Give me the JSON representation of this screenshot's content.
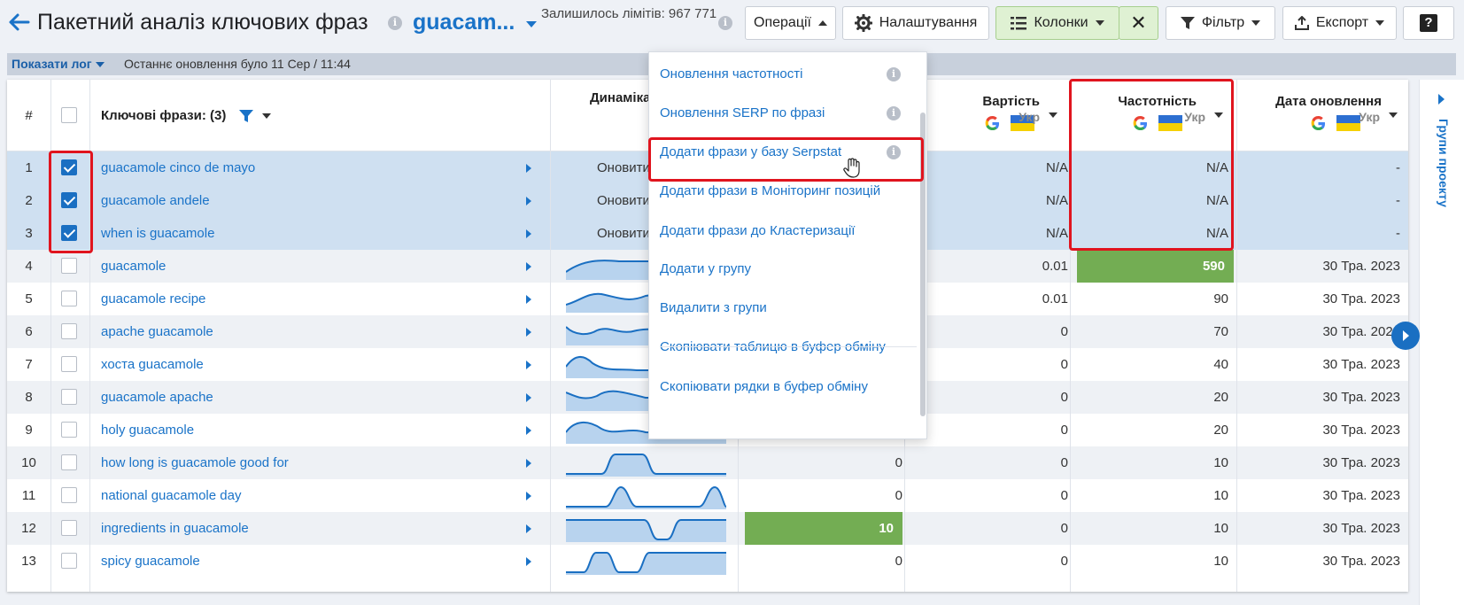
{
  "header": {
    "title": "Пакетний аналіз ключових фраз",
    "project": "guacam...",
    "limits": "Залишилось лімітів: 967 771",
    "buttons": {
      "operations": "Операції",
      "settings": "Налаштування",
      "columns": "Колонки",
      "filter": "Фільтр",
      "export": "Експорт"
    }
  },
  "logbar": {
    "toggle": "Показати лог",
    "text": "Останнє оновлення було 11 Сер / 11:44"
  },
  "table": {
    "headers": {
      "num": "#",
      "keywords": "Ключові фрази: (3)",
      "dynamics": "Динаміка",
      "cost": "Вартість",
      "frequency": "Частотність",
      "updated": "Дата оновлення",
      "region": "Укр"
    },
    "rows": [
      {
        "n": "1",
        "kw": "guacamole cinco de mayo",
        "checked": true,
        "update": "Оновити",
        "v1": "",
        "cost": "N/A",
        "freq": "N/A",
        "date": "-"
      },
      {
        "n": "2",
        "kw": "guacamole andele",
        "checked": true,
        "update": "Оновити",
        "v1": "",
        "cost": "N/A",
        "freq": "N/A",
        "date": "-"
      },
      {
        "n": "3",
        "kw": "when is guacamole",
        "checked": true,
        "update": "Оновити",
        "v1": "",
        "cost": "N/A",
        "freq": "N/A",
        "date": "-"
      },
      {
        "n": "4",
        "kw": "guacamole",
        "checked": false,
        "update": "",
        "v1": "",
        "cost": "0.01",
        "freq": "590",
        "date": "30 Тра. 2023",
        "freqHl": true
      },
      {
        "n": "5",
        "kw": "guacamole recipe",
        "checked": false,
        "update": "",
        "v1": "",
        "cost": "0.01",
        "freq": "90",
        "date": "30 Тра. 2023"
      },
      {
        "n": "6",
        "kw": "apache guacamole",
        "checked": false,
        "update": "",
        "v1": "",
        "cost": "0",
        "freq": "70",
        "date": "30 Тра. 2023"
      },
      {
        "n": "7",
        "kw": "хоста guacamole",
        "checked": false,
        "update": "",
        "v1": "",
        "cost": "0",
        "freq": "40",
        "date": "30 Тра. 2023"
      },
      {
        "n": "8",
        "kw": "guacamole apache",
        "checked": false,
        "update": "",
        "v1": "",
        "cost": "0",
        "freq": "20",
        "date": "30 Тра. 2023"
      },
      {
        "n": "9",
        "kw": "holy guacamole",
        "checked": false,
        "update": "",
        "v1": "",
        "cost": "0",
        "freq": "20",
        "date": "30 Тра. 2023"
      },
      {
        "n": "10",
        "kw": "how long is guacamole good for",
        "checked": false,
        "update": "",
        "v1": "0",
        "cost": "0",
        "freq": "10",
        "date": "30 Тра. 2023"
      },
      {
        "n": "11",
        "kw": "national guacamole day",
        "checked": false,
        "update": "",
        "v1": "0",
        "cost": "0",
        "freq": "10",
        "date": "30 Тра. 2023"
      },
      {
        "n": "12",
        "kw": "ingredients in guacamole",
        "checked": false,
        "update": "",
        "v1": "10",
        "cost": "0",
        "freq": "10",
        "date": "30 Тра. 2023",
        "v1Hl": true
      },
      {
        "n": "13",
        "kw": "spicy guacamole",
        "checked": false,
        "update": "",
        "v1": "0",
        "cost": "0",
        "freq": "10",
        "date": "30 Тра. 2023"
      }
    ]
  },
  "dropdown": {
    "items": [
      "Оновлення частотності",
      "Оновлення SERP по фразі",
      "Додати фрази у базу Serpstat",
      "Додати фрази в Моніторинг позицій",
      "Додати фрази до Кластеризації",
      "Додати у групу",
      "Видалити з групи",
      "Скопіювати таблицю в буфер обміну",
      "Скопіювати рядки в буфер обміну"
    ]
  },
  "side": {
    "label": "Групи проекту"
  },
  "colors": {
    "accent": "#1a73c8",
    "highlight": "#e0141e",
    "green": "#73ad53"
  }
}
